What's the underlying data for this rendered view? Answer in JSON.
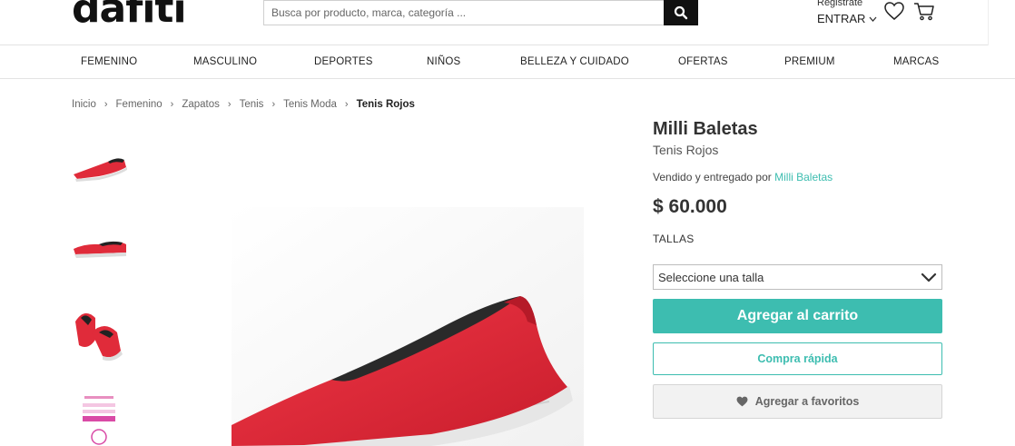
{
  "header": {
    "logo": "dafiti",
    "search_placeholder": "Busca por producto, marca, categoría ...",
    "register_label": "Registrate",
    "login_label": "ENTRAR"
  },
  "nav": {
    "items": [
      "FEMENINO",
      "MASCULINO",
      "DEPORTES",
      "NIÑOS",
      "BELLEZA Y CUIDADO",
      "OFERTAS",
      "PREMIUM",
      "MARCAS"
    ]
  },
  "breadcrumb": [
    "Inicio",
    "Femenino",
    "Zapatos",
    "Tenis",
    "Tenis Moda",
    "Tenis Rojos"
  ],
  "product": {
    "brand": "Milli Baletas",
    "name": "Tenis Rojos",
    "seller_prefix": "Vendido y entregado por",
    "seller_name": "Milli Baletas",
    "price": "$ 60.000",
    "sizes_label": "TALLAS",
    "size_select_value": "Seleccione una talla",
    "add_to_cart_label": "Agregar al carrito",
    "quick_buy_label": "Compra rápida",
    "favorites_label": "Agregar a favoritos"
  },
  "colors": {
    "accent": "#3dbdb0",
    "shoe_red": "#e02b3a",
    "black": "#111111"
  },
  "icons": [
    "search-icon",
    "chevron-down-icon",
    "heart-icon",
    "cart-icon",
    "chevron-right-icon"
  ]
}
